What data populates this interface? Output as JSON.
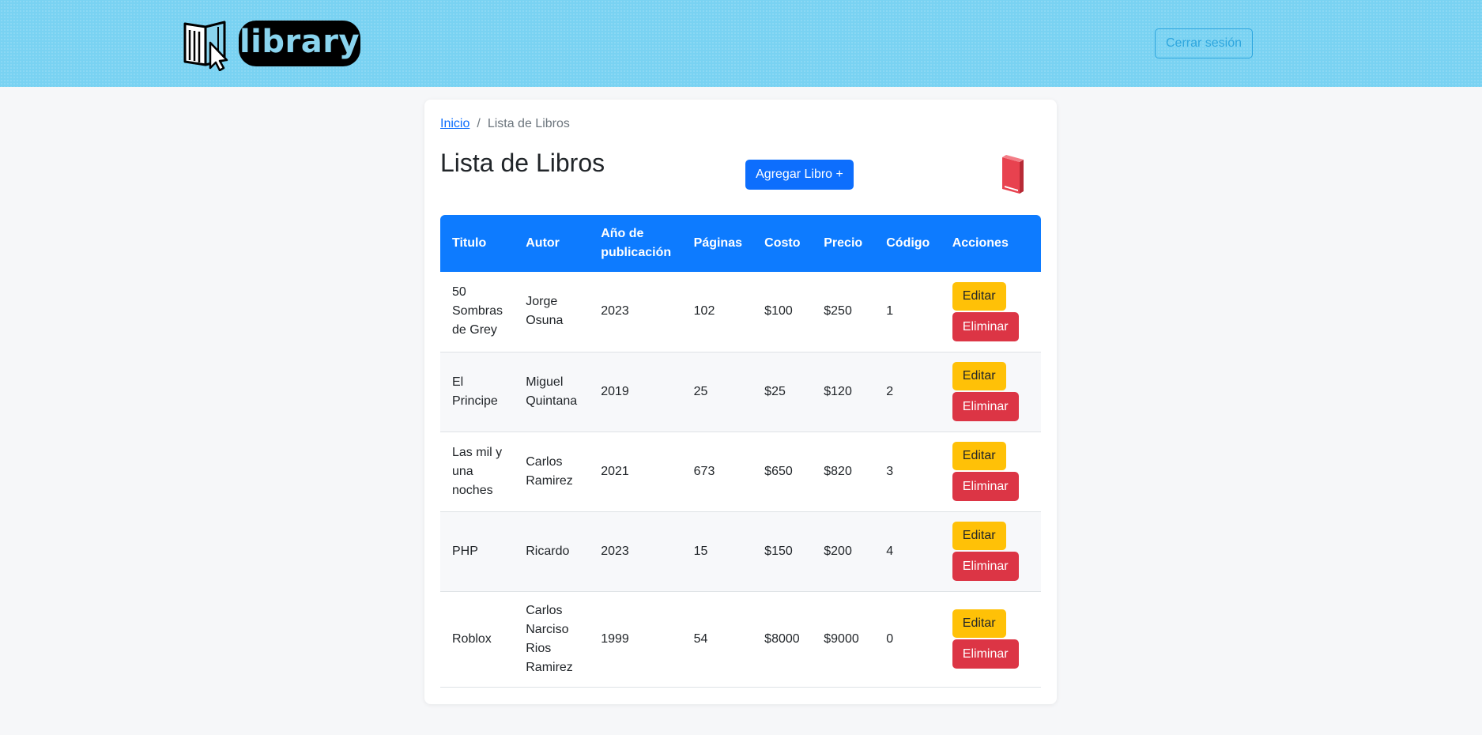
{
  "header": {
    "logo_text": "library",
    "logout_label": "Cerrar sesión"
  },
  "breadcrumb": {
    "home": "Inicio",
    "separator": "/",
    "current": "Lista de Libros"
  },
  "page": {
    "title": "Lista de Libros",
    "add_button_label": "Agregar Libro +"
  },
  "table": {
    "columns": [
      "Titulo",
      "Autor",
      "Año de publicación",
      "Páginas",
      "Costo",
      "Precio",
      "Código",
      "Acciones"
    ],
    "edit_label": "Editar",
    "delete_label": "Eliminar",
    "rows": [
      {
        "titulo": "50 Sombras de Grey",
        "autor": "Jorge Osuna",
        "anio": "2023",
        "paginas": "102",
        "costo": "$100",
        "precio": "$250",
        "codigo": "1"
      },
      {
        "titulo": "El Principe",
        "autor": "Miguel Quintana",
        "anio": "2019",
        "paginas": "25",
        "costo": "$25",
        "precio": "$120",
        "codigo": "2"
      },
      {
        "titulo": "Las mil y una noches",
        "autor": "Carlos Ramirez",
        "anio": "2021",
        "paginas": "673",
        "costo": "$650",
        "precio": "$820",
        "codigo": "3"
      },
      {
        "titulo": "PHP",
        "autor": "Ricardo",
        "anio": "2023",
        "paginas": "15",
        "costo": "$150",
        "precio": "$200",
        "codigo": "4"
      },
      {
        "titulo": "Roblox",
        "autor": "Carlos Narciso Rios Ramirez",
        "anio": "1999",
        "paginas": "54",
        "costo": "$8000",
        "precio": "$9000",
        "codigo": "0"
      }
    ]
  },
  "colors": {
    "header_bg": "#79d2f2",
    "primary": "#0d6efd",
    "warning": "#ffc107",
    "danger": "#dc3545",
    "table_header": "#0d7bff"
  },
  "icons": {
    "logo": "open-book-cursor-icon",
    "decoration": "red-book-icon"
  }
}
